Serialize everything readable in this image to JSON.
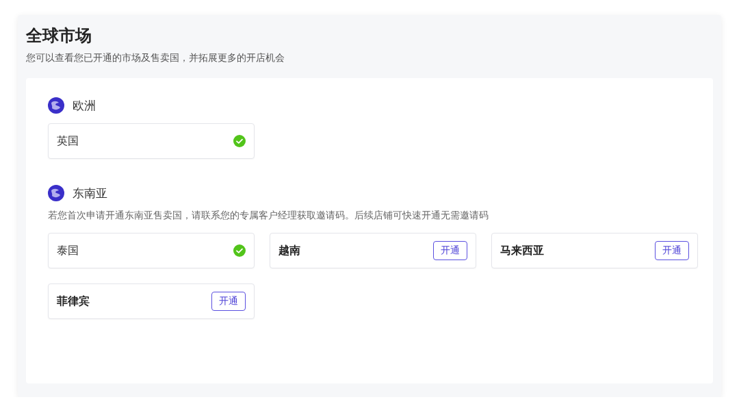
{
  "header": {
    "title": "全球市场",
    "subtitle": "您可以查看您已开通的市场及售卖国，并拓展更多的开店机会"
  },
  "regions": [
    {
      "name": "欧洲",
      "countries": [
        {
          "name": "英国",
          "opened": true
        }
      ]
    },
    {
      "name": "东南亚",
      "note": "若您首次申请开通东南亚售卖国，请联系您的专属客户经理获取邀请码。后续店铺可快速开通无需邀请码",
      "countries": [
        {
          "name": "泰国",
          "opened": true
        },
        {
          "name": "越南",
          "opened": false,
          "button": "开通"
        },
        {
          "name": "马来西亚",
          "opened": false,
          "button": "开通"
        },
        {
          "name": "菲律宾",
          "opened": false,
          "button": "开通"
        }
      ]
    }
  ]
}
